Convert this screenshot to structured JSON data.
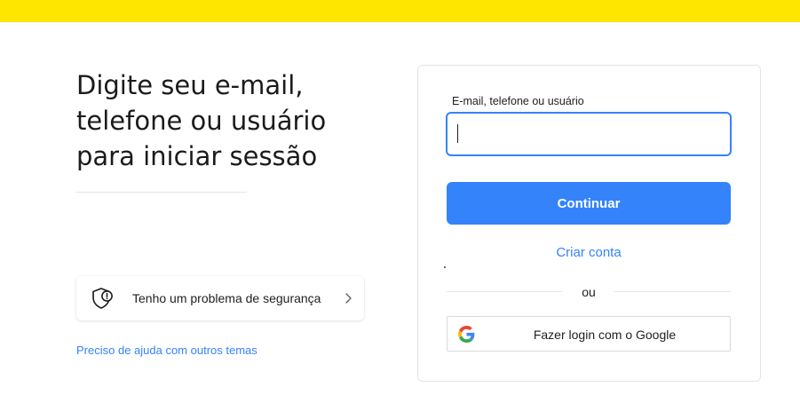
{
  "header": {
    "accent_color": "#ffe600"
  },
  "intro": {
    "headline_line1": "Digite seu e-mail,",
    "headline_line2": "telefone ou usuário",
    "headline_line3": "para iniciar sessão"
  },
  "security": {
    "label": "Tenho um problema de segurança",
    "icon": "shield-alert-icon"
  },
  "help": {
    "link_label": "Preciso de ajuda com outros temas"
  },
  "login": {
    "field_label": "E-mail, telefone ou usuário",
    "field_value": "",
    "continue_label": "Continuar",
    "create_account_label": "Criar conta",
    "separator_label": "ou",
    "google_label": "Fazer login com o Google",
    "primary_color": "#3483fa"
  }
}
